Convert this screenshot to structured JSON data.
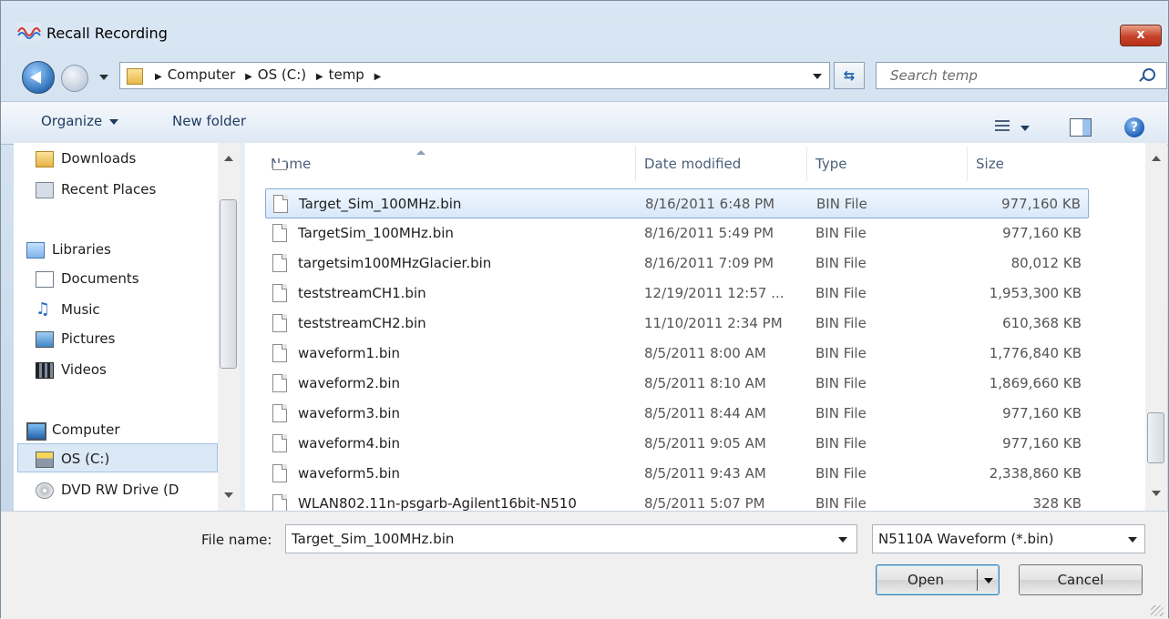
{
  "window": {
    "title": "Recall Recording",
    "close_label": "x"
  },
  "address": {
    "crumbs": [
      "Computer",
      "OS (C:)",
      "temp"
    ],
    "search_placeholder": "Search temp"
  },
  "toolbar": {
    "organize": "Organize",
    "new_folder": "New folder",
    "help": "?"
  },
  "nav": {
    "items": [
      {
        "label": "Downloads",
        "icon": "downloads-folder-icon"
      },
      {
        "label": "Recent Places",
        "icon": "recent-places-icon"
      },
      {
        "label": "Libraries",
        "icon": "libraries-icon"
      },
      {
        "label": "Documents",
        "icon": "documents-icon"
      },
      {
        "label": "Music",
        "icon": "music-icon"
      },
      {
        "label": "Pictures",
        "icon": "pictures-icon"
      },
      {
        "label": "Videos",
        "icon": "videos-icon"
      },
      {
        "label": "Computer",
        "icon": "computer-icon"
      },
      {
        "label": "OS (C:)",
        "icon": "drive-icon"
      },
      {
        "label": "DVD RW Drive (D",
        "icon": "dvd-drive-icon"
      }
    ],
    "selected": "OS (C:)"
  },
  "columns": {
    "name": "Name",
    "date": "Date modified",
    "type": "Type",
    "size": "Size"
  },
  "files": [
    {
      "name": "Target_Sim_100MHz.bin",
      "date": "8/16/2011 6:48 PM",
      "type": "BIN File",
      "size": "977,160 KB"
    },
    {
      "name": "TargetSim_100MHz.bin",
      "date": "8/16/2011 5:49 PM",
      "type": "BIN File",
      "size": "977,160 KB"
    },
    {
      "name": "targetsim100MHzGlacier.bin",
      "date": "8/16/2011 7:09 PM",
      "type": "BIN File",
      "size": "80,012 KB"
    },
    {
      "name": "teststreamCH1.bin",
      "date": "12/19/2011 12:57 ...",
      "type": "BIN File",
      "size": "1,953,300 KB"
    },
    {
      "name": "teststreamCH2.bin",
      "date": "11/10/2011 2:34 PM",
      "type": "BIN File",
      "size": "610,368 KB"
    },
    {
      "name": "waveform1.bin",
      "date": "8/5/2011 8:00 AM",
      "type": "BIN File",
      "size": "1,776,840 KB"
    },
    {
      "name": "waveform2.bin",
      "date": "8/5/2011 8:10 AM",
      "type": "BIN File",
      "size": "1,869,660 KB"
    },
    {
      "name": "waveform3.bin",
      "date": "8/5/2011 8:44 AM",
      "type": "BIN File",
      "size": "977,160 KB"
    },
    {
      "name": "waveform4.bin",
      "date": "8/5/2011 9:05 AM",
      "type": "BIN File",
      "size": "977,160 KB"
    },
    {
      "name": "waveform5.bin",
      "date": "8/5/2011 9:43 AM",
      "type": "BIN File",
      "size": "2,338,860 KB"
    },
    {
      "name": "WLAN802.11n-psgarb-Agilent16bit-N510",
      "date": "8/5/2011 5:07 PM",
      "type": "BIN File",
      "size": "328 KB"
    }
  ],
  "selected_file": "Target_Sim_100MHz.bin",
  "bottom": {
    "file_name_label": "File name:",
    "file_name_value": "Target_Sim_100MHz.bin",
    "file_type": "N5110A Waveform (*.bin)",
    "open_label": "Open",
    "cancel_label": "Cancel"
  }
}
